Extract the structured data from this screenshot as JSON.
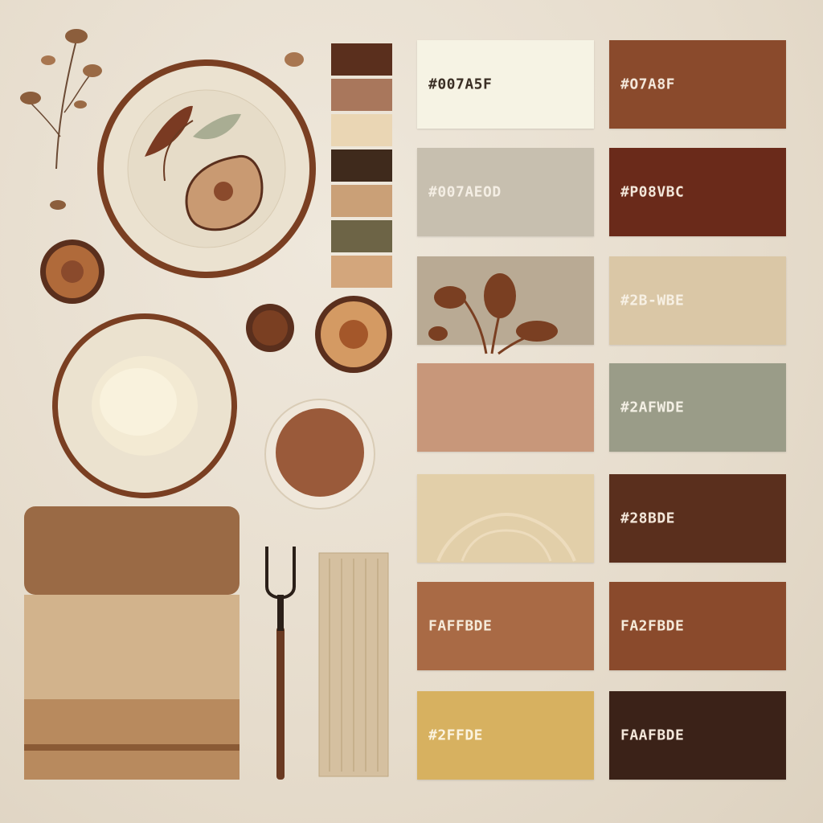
{
  "palette": {
    "swatches": [
      {
        "label": "#007A5F",
        "color": "#f6f3e4",
        "text_color": "#3a2e24"
      },
      {
        "label": "#O7A8F",
        "color": "#8a4a2c",
        "text_color": "#f3e7da"
      },
      {
        "label": "#007AEOD",
        "color": "#c7bfaf",
        "text_color": "#f4eee4"
      },
      {
        "label": "#P08VBC",
        "color": "#6a2a1a",
        "text_color": "#f3e7da"
      },
      {
        "label": "",
        "color": "#b9aa94",
        "text_color": "#ffffff"
      },
      {
        "label": "#2B-WBE",
        "color": "#dac7a6",
        "text_color": "#f7f0e4"
      },
      {
        "label": "",
        "color": "#c8977a",
        "text_color": "#ffffff"
      },
      {
        "label": "#2AFWDE",
        "color": "#9a9c88",
        "text_color": "#f3efe4"
      },
      {
        "label": "",
        "color": "#e2cfa9",
        "text_color": "#ffffff"
      },
      {
        "label": "#28BDE",
        "color": "#5a2f1d",
        "text_color": "#f3e7da"
      },
      {
        "label": "FAFFBDE",
        "color": "#a96a45",
        "text_color": "#f5ead9"
      },
      {
        "label": "FA2FBDE",
        "color": "#8a4a2c",
        "text_color": "#f5ead9"
      },
      {
        "label": "#2FFDE",
        "color": "#d7b160",
        "text_color": "#fbf3df"
      },
      {
        "label": "FAAFBDE",
        "color": "#3b2218",
        "text_color": "#f3e7da"
      }
    ],
    "strip_colors": [
      "#5a2f1d",
      "#a9775c",
      "#ead6b4",
      "#3f2a1c",
      "#caa077",
      "#6d6446",
      "#d3a67c"
    ]
  }
}
